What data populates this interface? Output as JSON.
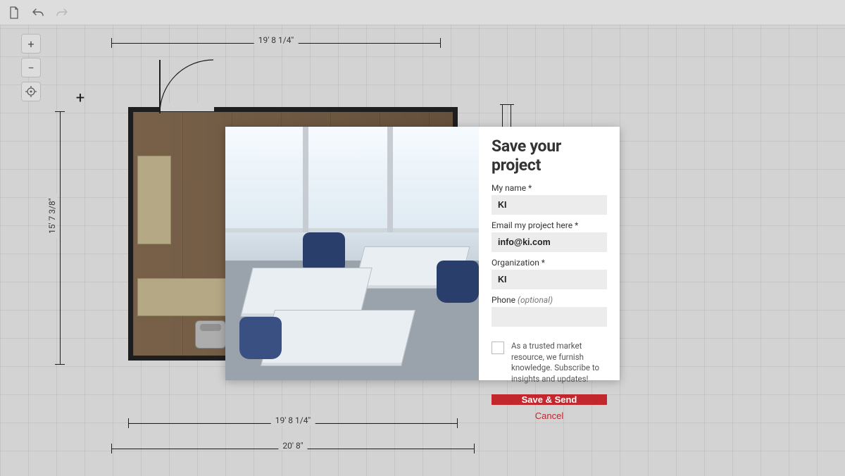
{
  "toolbar": {
    "new_icon": "new-doc-icon",
    "undo_icon": "undo-icon",
    "redo_icon": "redo-icon"
  },
  "tools": {
    "zoom_in": "+",
    "zoom_out": "−",
    "recenter": "⊕"
  },
  "dimensions": {
    "top_width": "19' 8 1/4\"",
    "bottom_width": "19' 8 1/4\"",
    "overall_width": "20' 8\"",
    "left_height": "15' 7 3/8\""
  },
  "modal": {
    "title": "Save your project",
    "name_label": "My name *",
    "name_value": "KI",
    "email_label": "Email my project here *",
    "email_value": "info@ki.com",
    "org_label": "Organization *",
    "org_value": "KI",
    "phone_label": "Phone",
    "phone_optional": "(optional)",
    "phone_value": "",
    "subscribe_text": "As a trusted market resource, we furnish knowledge. Subscribe to insights and updates!",
    "save_label": "Save & Send",
    "cancel_label": "Cancel"
  }
}
